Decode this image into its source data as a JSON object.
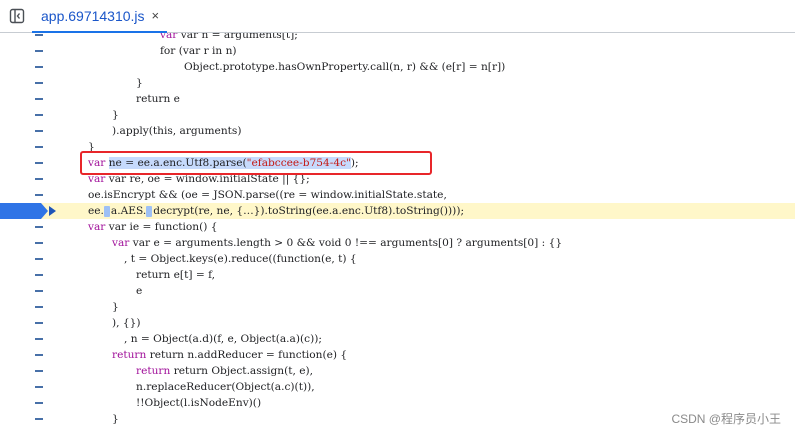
{
  "tab": {
    "filename": "app.69714310.js",
    "close_glyph": "×"
  },
  "code_lines": {
    "l1": [
      "var n = arguments[t];"
    ],
    "l2": [
      "for (var r in n)"
    ],
    "l3": [
      "Object.prototype.hasOwnProperty.call(n, r) && (e[r] = n[r])"
    ],
    "l4": [
      "}"
    ],
    "l5": [
      "return e"
    ],
    "l6": [
      "}"
    ],
    "l7": [
      ").apply(this, arguments)"
    ],
    "l8": [
      "}"
    ],
    "l9": [
      "var ",
      "ne = ee.a.enc.Utf8.parse(",
      "\"efabccee-b754-4c\"",
      ");"
    ],
    "l10": [
      "var re, oe = window.initialState || {};"
    ],
    "l11": [
      "oe.isEncrypt && (oe = JSON.parse((re = window.initialState.state,"
    ],
    "l12": [
      "ee.",
      "a.AES.",
      "decrypt(re, ne, {",
      "…",
      "}).toString(ee.a.enc.Utf8).toString())));"
    ],
    "l13": [
      "var ie = function() {"
    ],
    "l14": [
      "var e = arguments.length > 0 && void 0 !== arguments[0] ? arguments[0] : {}"
    ],
    "l15": [
      ", t = Object.keys(e).reduce((function(e, t) {"
    ],
    "l16": [
      "return e[t] = f,"
    ],
    "l17": [
      "e"
    ],
    "l18": [
      "}"
    ],
    "l19": [
      "), {})"
    ],
    "l20": [
      ", n = Object(a.d)(f, e, Object(a.a)(c));"
    ],
    "l21": [
      "return n.addReducer = function(e) {"
    ],
    "l22": [
      "return Object.assign(t, e),"
    ],
    "l23": [
      "n.replaceReducer(Object(a.c)(t)),"
    ],
    "l24": [
      "!!Object(l.isNodeEnv)()"
    ],
    "l25": [
      "}"
    ]
  },
  "watermark": "CSDN @程序员小王",
  "colors": {
    "keyword": "#a0109a",
    "string": "#c41a16",
    "breakpoint": "#2f74e6",
    "highlight_box": "#e8262a",
    "paused_line_bg": "#fff7c9"
  }
}
